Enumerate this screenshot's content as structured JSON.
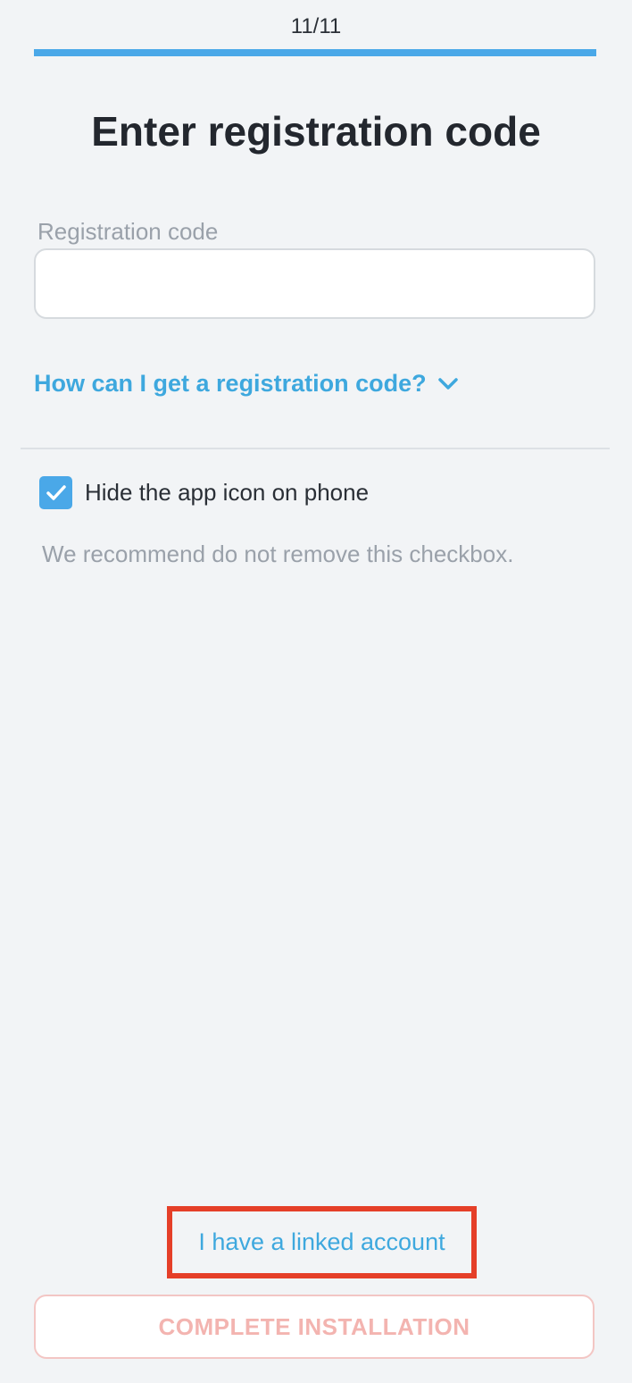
{
  "progress": {
    "step_text": "11/11",
    "fraction": 1.0,
    "color": "#4aa8e8"
  },
  "page": {
    "title": "Enter registration code"
  },
  "form": {
    "code_label": "Registration code",
    "code_value": "",
    "code_placeholder": "",
    "help_link": "How can I get a registration code?",
    "help_icon": "chevron-down-icon"
  },
  "options": {
    "hide_icon_label": "Hide the app icon on phone",
    "hide_icon_checked": true,
    "hint": "We recommend do not remove this checkbox."
  },
  "footer": {
    "linked_account_label": "I have a linked account",
    "highlight_color": "#e53f28",
    "complete_button_label": "COMPLETE INSTALLATION",
    "complete_button_enabled": false
  }
}
